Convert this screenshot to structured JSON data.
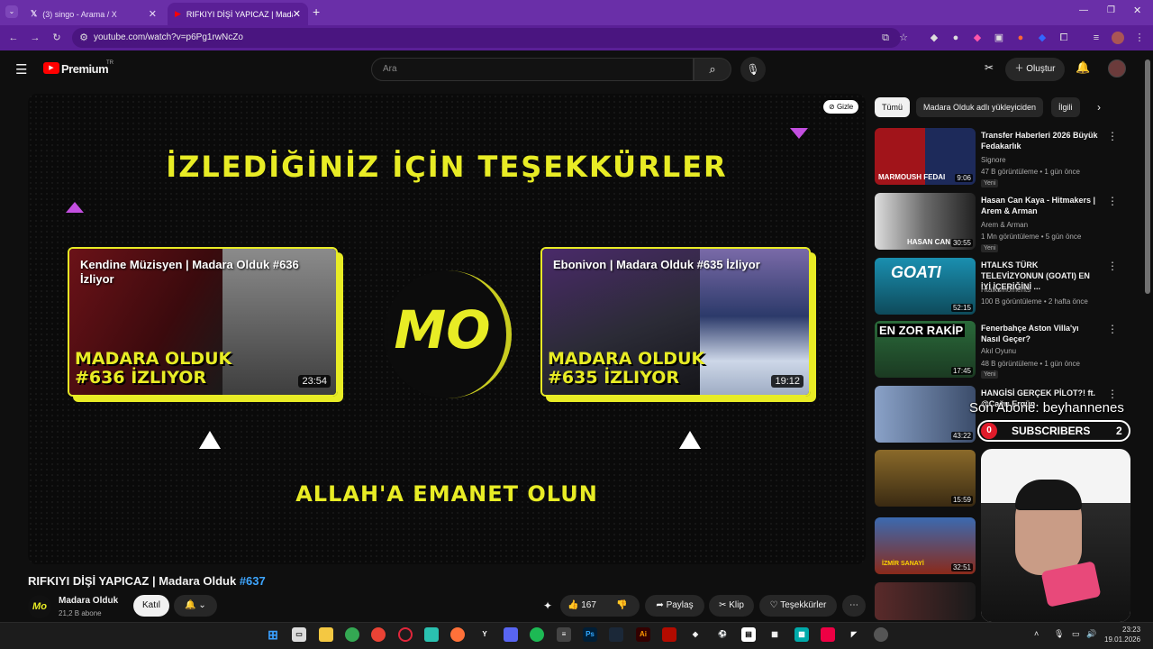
{
  "browser": {
    "tabs": [
      {
        "label": "(3) singo - Arama / X",
        "icon": "x-logo-icon"
      },
      {
        "label": "RIFKIYI DİŞİ YAPICAZ | Madara O",
        "icon": "youtube-icon"
      }
    ],
    "new_tab": "+",
    "url": "youtube.com/watch?v=p6Pg1rwNcZo"
  },
  "youtube": {
    "logo": "Premium",
    "region": "TR",
    "search_placeholder": "Ara",
    "create_label": "Oluştur"
  },
  "player": {
    "hide_label": "Gizle",
    "thanks": "İZLEDİĞİNİZ İÇİN TEŞEKKÜRLER",
    "goodbye": "ALLAH'A EMANET OLUN",
    "center_logo": "MO",
    "end_cards": [
      {
        "title": "Kendine Müzisyen | Madara Olduk #636 İzliyor",
        "big1": "MADARA OLDUK",
        "big2": "#636 İZLIYOR",
        "duration": "23:54"
      },
      {
        "title": "Ebonivon | Madara Olduk #635 İzliyor",
        "big1": "MADARA OLDUK",
        "big2": "#635 İZLIYOR",
        "duration": "19:12"
      }
    ]
  },
  "video": {
    "title": "RIFKIYI DİŞİ YAPICAZ | Madara Olduk ",
    "hashtag": "#637",
    "channel": "Madara Olduk",
    "subscribers": "21,2 B abone",
    "join": "Katıl",
    "likes": "167",
    "share": "Paylaş",
    "clip": "Klip",
    "thanks": "Teşekkürler"
  },
  "sidebar": {
    "chips": [
      "Tümü",
      "Madara Olduk adlı yükleyiciden",
      "İlgili"
    ],
    "items": [
      {
        "title": "Transfer Haberleri 2026 Büyük Fedakarlık",
        "channel": "Signore",
        "meta": "47 B görüntüleme • 1 gün önce",
        "badge": "Yeni",
        "duration": "9:06",
        "thumb_text": "MARMOUSH  FEDAI"
      },
      {
        "title": "Hasan Can Kaya - Hitmakers | Arem & Arman",
        "channel": "Arem & Arman",
        "meta": "1 Mn görüntüleme • 5 gün önce",
        "badge": "Yeni",
        "duration": "30:55",
        "thumb_text": "HASAN CAN"
      },
      {
        "title": "HTALKS TÜRK TELEVİZYONUN (GOATI) EN İYİ İÇERİĞİNİ ...",
        "channel": "Htalksmoments",
        "meta": "100 B görüntüleme • 2 hafta önce",
        "badge": "",
        "duration": "52:15",
        "thumb_text": "GOATI"
      },
      {
        "title": "Fenerbahçe Aston Villa'yı Nasıl Geçer?",
        "channel": "Akıl Oyunu",
        "meta": "48 B görüntüleme • 1 gün önce",
        "badge": "Yeni",
        "duration": "17:45",
        "thumb_text": "EN ZOR RAKİP"
      },
      {
        "title": "HANGİSİ GERÇEK PİLOT?! ft. @Çağrı Ergün",
        "channel": "",
        "meta": "",
        "badge": "",
        "duration": "43:22",
        "thumb_text": ""
      },
      {
        "title": "",
        "channel": "",
        "meta": "",
        "badge": "",
        "duration": "15:59",
        "thumb_text": ""
      },
      {
        "title": "",
        "channel": "",
        "meta": "",
        "badge": "",
        "duration": "32:51",
        "thumb_text": "İZMİR SANAYİ"
      },
      {
        "title": "",
        "channel": "",
        "meta": "",
        "badge": "",
        "duration": "",
        "thumb_text": ""
      }
    ]
  },
  "overlay": {
    "last_sub": "Son Abone: beyhannenes",
    "sub_left": "0",
    "sub_label": "SUBSCRIBERS",
    "sub_right": "2"
  },
  "taskbar": {
    "time": "23:23",
    "date": "19.01.2026"
  },
  "colors": {
    "accent_yellow": "#e8ec25",
    "browser_purple": "#5a1f96",
    "yt_red": "#ff0000",
    "link_blue": "#3ea6ff"
  }
}
